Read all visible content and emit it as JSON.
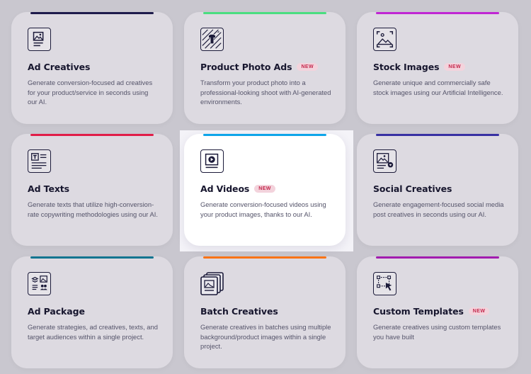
{
  "badge_label": "NEW",
  "cards": [
    {
      "title": "Ad Creatives",
      "desc": "Generate conversion-focused ad creatives for your product/service in seconds using our AI.",
      "accent": "#1e1b4b",
      "icon": "ad-creatives-icon"
    },
    {
      "title": "Product Photo Ads",
      "badge": "NEW",
      "desc": "Transform your product photo into a professional-looking shoot with AI-generated environments.",
      "accent": "#4ade80",
      "icon": "product-photo-icon"
    },
    {
      "title": "Stock Images",
      "badge": "NEW",
      "desc": "Generate unique and commercially safe stock images using our Artificial Intelligence.",
      "accent": "#c026d3",
      "icon": "stock-images-icon"
    },
    {
      "title": "Ad Texts",
      "desc": "Generate texts that utilize high-conversion-rate copywriting methodologies using our AI.",
      "accent": "#e11d48",
      "icon": "ad-texts-icon"
    },
    {
      "title": "Ad Videos",
      "badge": "NEW",
      "desc": "Generate conversion-focused videos using your product images, thanks to our AI.",
      "accent": "#0ea5e9",
      "icon": "ad-videos-icon"
    },
    {
      "title": "Social Creatives",
      "desc": "Generate engagement-focused social media post creatives in seconds using our AI.",
      "accent": "#3730a3",
      "icon": "social-creatives-icon"
    },
    {
      "title": "Ad Package",
      "desc": "Generate strategies, ad creatives, texts, and target audiences within a single project.",
      "accent": "#0e7490",
      "icon": "ad-package-icon"
    },
    {
      "title": "Batch Creatives",
      "desc": "Generate creatives in batches using multiple background/product images within a single project.",
      "accent": "#f97316",
      "icon": "batch-creatives-icon"
    },
    {
      "title": "Custom Templates",
      "badge": "NEW",
      "desc": "Generate creatives using custom templates you have built",
      "accent": "#a21caf",
      "icon": "custom-templates-icon"
    }
  ]
}
